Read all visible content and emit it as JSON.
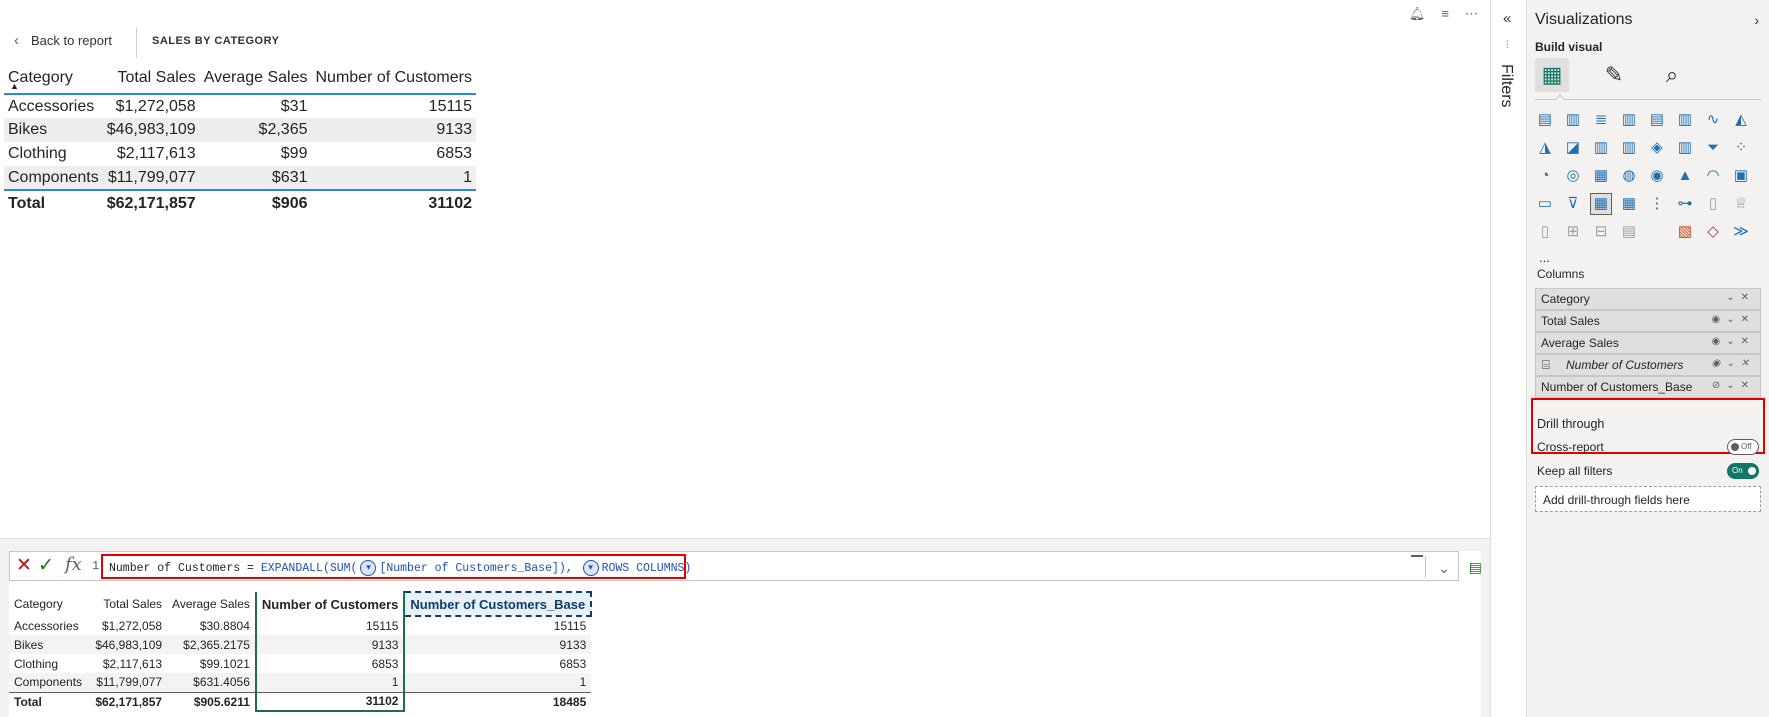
{
  "canvas": {
    "back_label": "Back to report",
    "page_title": "SALES BY CATEGORY",
    "icons": [
      "bell-icon",
      "filter-icon",
      "more-icon"
    ]
  },
  "visual_table": {
    "headers": [
      "Category",
      "Total Sales",
      "Average Sales",
      "Number of Customers"
    ],
    "rows": [
      [
        "Accessories",
        "$1,272,058",
        "$31",
        "15115"
      ],
      [
        "Bikes",
        "$46,983,109",
        "$2,365",
        "9133"
      ],
      [
        "Clothing",
        "$2,117,613",
        "$99",
        "6853"
      ],
      [
        "Components",
        "$11,799,077",
        "$631",
        "1"
      ]
    ],
    "total": [
      "Total",
      "$62,171,857",
      "$906",
      "31102"
    ]
  },
  "formula_bar": {
    "line_number": "1",
    "code_part1": "Number of Customers = ",
    "code_fn": "EXPANDALL(SUM(",
    "code_arg": "[Number of Customers_Base]),",
    "code_kw": "ROWS COLUMNS)"
  },
  "result_table": {
    "headers": [
      "Category",
      "Total Sales",
      "Average Sales",
      "Number of Customers",
      "Number of Customers_Base"
    ],
    "rows": [
      [
        "Accessories",
        "$1,272,058",
        "$30.8804",
        "15115",
        "15115"
      ],
      [
        "Bikes",
        "$46,983,109",
        "$2,365.2175",
        "9133",
        "9133"
      ],
      [
        "Clothing",
        "$2,117,613",
        "$99.1021",
        "6853",
        "6853"
      ],
      [
        "Components",
        "$11,799,077",
        "$631.4056",
        "1",
        "1"
      ]
    ],
    "total": [
      "Total",
      "$62,171,857",
      "$905.6211",
      "31102",
      "18485"
    ]
  },
  "filters": {
    "label": "Filters"
  },
  "viz_pane": {
    "title": "Visualizations",
    "build_label": "Build visual",
    "more": "...",
    "columns_label": "Columns",
    "wells": [
      "Category",
      "Total Sales",
      "Average Sales",
      "Number of Customers",
      "Number of Customers_Base"
    ],
    "drill_label": "Drill through",
    "cross_report_label": "Cross-report",
    "cross_report_state": "Off",
    "keep_filters_label": "Keep all filters",
    "keep_filters_state": "On",
    "drop_label": "Add drill-through fields here"
  }
}
